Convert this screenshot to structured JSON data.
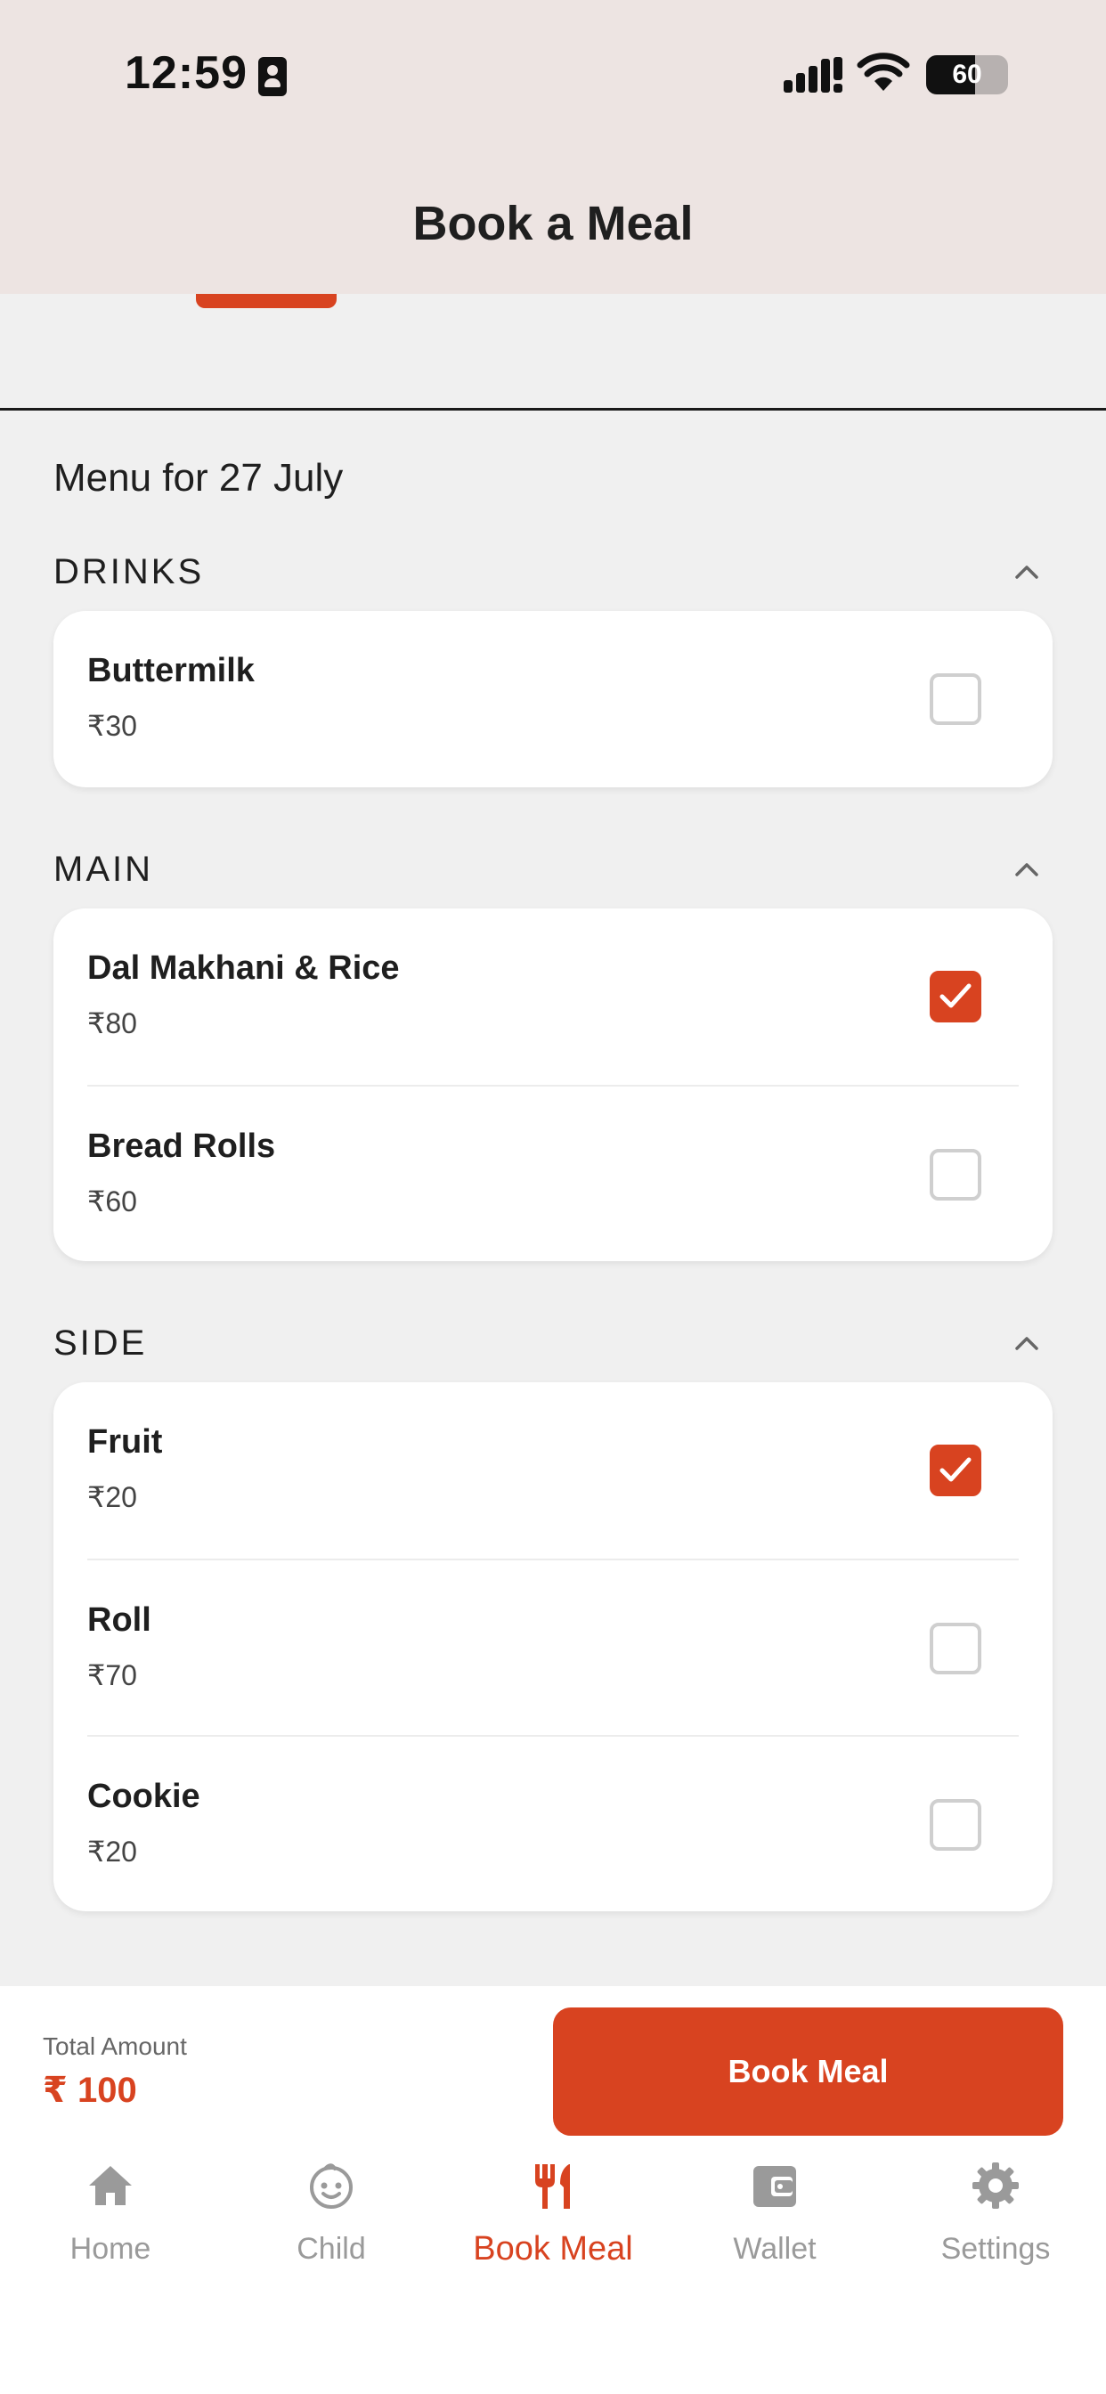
{
  "status_bar": {
    "time": "12:59",
    "battery": "60",
    "battery_level": 0.6
  },
  "header": {
    "title": "Book a Meal"
  },
  "menu": {
    "heading": "Menu for 27 July",
    "sections": [
      {
        "label": "DRINKS",
        "items": [
          {
            "name": "Buttermilk",
            "price": "₹30",
            "checked": false
          }
        ]
      },
      {
        "label": "MAIN",
        "items": [
          {
            "name": "Dal Makhani & Rice",
            "price": "₹80",
            "checked": true
          },
          {
            "name": "Bread Rolls",
            "price": "₹60",
            "checked": false
          }
        ]
      },
      {
        "label": "SIDE",
        "items": [
          {
            "name": "Fruit",
            "price": "₹20",
            "checked": true
          },
          {
            "name": "Roll",
            "price": "₹70",
            "checked": false
          },
          {
            "name": "Cookie",
            "price": "₹20",
            "checked": false
          }
        ]
      }
    ]
  },
  "footer": {
    "total_label": "Total Amount",
    "total_value": "₹ 100",
    "book_button": "Book Meal"
  },
  "nav": {
    "items": [
      {
        "label": "Home",
        "icon": "home-icon"
      },
      {
        "label": "Child",
        "icon": "child-face-icon"
      },
      {
        "label": "Book Meal",
        "icon": "fork-knife-icon",
        "active": true
      },
      {
        "label": "Wallet",
        "icon": "wallet-icon"
      },
      {
        "label": "Settings",
        "icon": "gear-icon"
      }
    ]
  },
  "colors": {
    "accent": "#d84320",
    "header_bg": "#ede4e2",
    "page_bg": "#f0f0f0"
  }
}
